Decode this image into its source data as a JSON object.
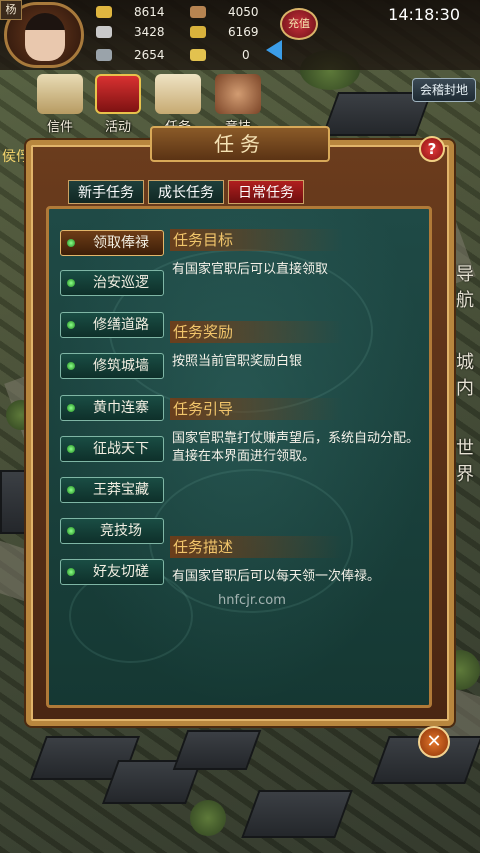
{
  "hud": {
    "player_name": "杨",
    "resources": [
      {
        "id": "gold",
        "value": "8614",
        "color": "#e0b640"
      },
      {
        "id": "wood",
        "value": "4050",
        "color": "#b78451"
      },
      {
        "id": "silver",
        "value": "3428",
        "color": "#c9c9c9"
      },
      {
        "id": "grain",
        "value": "6169",
        "color": "#d9b23c"
      },
      {
        "id": "iron",
        "value": "2654",
        "color": "#9aa3aa"
      },
      {
        "id": "ingot",
        "value": "0",
        "color": "#e2c24f"
      }
    ],
    "recharge_label": "充值",
    "clock": "14:18:30",
    "fief_button": "会稽封地"
  },
  "menu": {
    "items": [
      {
        "id": "mail",
        "label": "信件"
      },
      {
        "id": "event",
        "label": "活动"
      },
      {
        "id": "task",
        "label": "任务"
      },
      {
        "id": "arena",
        "label": "竞技"
      }
    ],
    "side_label": "侯俘"
  },
  "vertical_nav": [
    "导航",
    "城内",
    "世界"
  ],
  "panel": {
    "title": "任务",
    "help": "?",
    "tabs": [
      {
        "label": "新手任务",
        "active": false
      },
      {
        "label": "成长任务",
        "active": false
      },
      {
        "label": "日常任务",
        "active": true
      }
    ],
    "tasks": [
      {
        "label": "领取俸禄",
        "active": true
      },
      {
        "label": "治安巡逻",
        "active": false
      },
      {
        "label": "修缮道路",
        "active": false
      },
      {
        "label": "修筑城墙",
        "active": false
      },
      {
        "label": "黄巾连寨",
        "active": false
      },
      {
        "label": "征战天下",
        "active": false
      },
      {
        "label": "王莽宝藏",
        "active": false
      },
      {
        "label": "竞技场",
        "active": false
      },
      {
        "label": "好友切磋",
        "active": false
      }
    ],
    "sections": [
      {
        "heading": "任务目标",
        "body": "有国家官职后可以直接领取"
      },
      {
        "heading": "任务奖励",
        "body": "按照当前官职奖励白银"
      },
      {
        "heading": "任务引导",
        "body": "国家官职靠打仗赚声望后，系统自动分配。直接在本界面进行领取。"
      },
      {
        "heading": "任务描述",
        "body": "有国家官职后可以每天领一次俸禄。"
      }
    ],
    "close": "✕"
  },
  "watermark": "hnfcjr.com"
}
